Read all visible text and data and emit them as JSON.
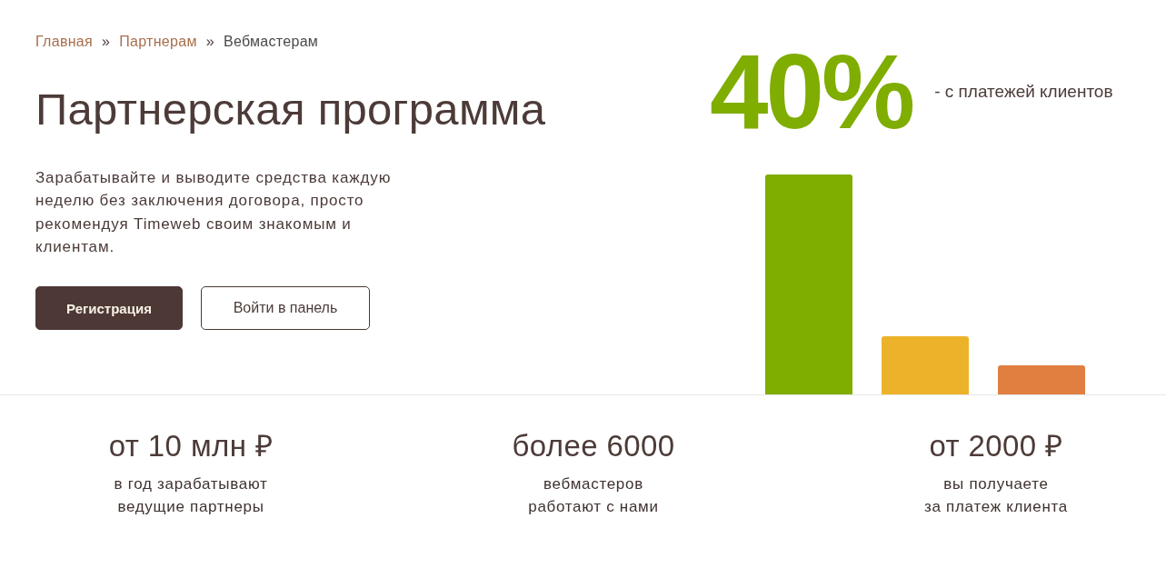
{
  "breadcrumb": {
    "items": [
      {
        "kind": "link",
        "label": "Главная"
      },
      {
        "kind": "separator",
        "label": "»"
      },
      {
        "kind": "link",
        "label": "Партнерам"
      },
      {
        "kind": "separator",
        "label": "»"
      },
      {
        "kind": "current",
        "label": "Вебмастерам"
      }
    ]
  },
  "hero": {
    "title": "Партнерская программа",
    "description": "Зарабатывайте и выводите средства каждую неделю без заключения договора, просто рекомендуя Timeweb своим знакомым и клиентам.",
    "buttons": [
      {
        "kind": "primary",
        "label": "Регистрация"
      },
      {
        "kind": "secondary",
        "label": "Войти в панель"
      }
    ]
  },
  "highlight": {
    "value": "40%",
    "caption": "- с платежей клиентов",
    "bars": [
      {
        "color": "#7fad00"
      },
      {
        "color": "#ecb22a"
      },
      {
        "color": "#e07f40"
      }
    ]
  },
  "stats": [
    {
      "value": "от 10 млн ₽",
      "description": "в год зарабатывают\nведущие партнеры"
    },
    {
      "value": "более 6000",
      "description": "вебмастеров\nработают с нами"
    },
    {
      "value": "от 2000 ₽",
      "description": "вы получаете\nза платеж клиента"
    }
  ]
}
